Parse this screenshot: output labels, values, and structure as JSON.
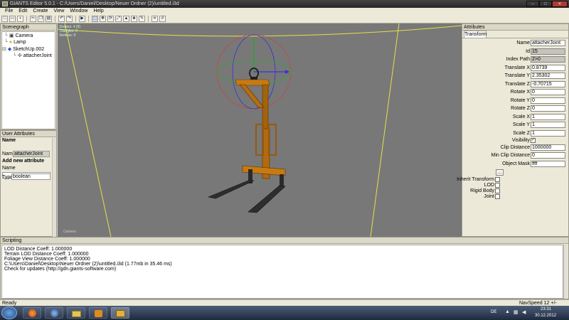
{
  "window": {
    "title": "GIANTS Editor 5.0.1 - C:/Users/Daniel/Desktop/Neuer Ordner (2)/untitled.i3d"
  },
  "menu": [
    "File",
    "Edit",
    "Create",
    "View",
    "Window",
    "Help"
  ],
  "toolbar_icons": [
    "new-icon",
    "open-icon",
    "save-icon",
    "cut-icon",
    "copy-icon",
    "paste-icon",
    "undo-icon",
    "redo-icon",
    "play-icon",
    "select-icon",
    "move-icon",
    "rotate-icon",
    "scale-icon",
    "terrain-icon",
    "foliage-icon",
    "paint-icon",
    "snap-icon"
  ],
  "scenegraph": {
    "title": "Scenegraph",
    "items": [
      {
        "label": "Camera",
        "icon": "camera-icon"
      },
      {
        "label": "Lamp",
        "icon": "lamp-icon"
      },
      {
        "label": "SketchUp.002",
        "icon": "cube-icon"
      },
      {
        "label": "attacherJoint",
        "icon": "joint-icon"
      }
    ]
  },
  "user_attributes": {
    "title": "User Attributes",
    "name_header": "Name",
    "name_label": "Name",
    "name_value": "attacherJoint",
    "add_header": "Add new attribute",
    "new_name_label": "Name",
    "new_name_value": "",
    "type_label": "Type",
    "type_value": "boolean"
  },
  "viewport": {
    "stats": [
      "Shapes: 4 (0)",
      "Triangles: 0",
      "Vertices: 0"
    ],
    "camera_label": "Camera"
  },
  "attributes": {
    "title": "Attributes",
    "tab": "Transform",
    "fields": [
      {
        "label": "Name",
        "value": "attacherJoint"
      },
      {
        "label": "Id",
        "value": "15"
      },
      {
        "label": "Index Path",
        "value": "2>0"
      },
      {
        "label": "Translate X",
        "value": "0.8739"
      },
      {
        "label": "Translate Y",
        "value": "2.35302"
      },
      {
        "label": "Translate Z",
        "value": "-0.70715"
      },
      {
        "label": "Rotate X",
        "value": "0"
      },
      {
        "label": "Rotate Y",
        "value": "0"
      },
      {
        "label": "Rotate Z",
        "value": "0"
      },
      {
        "label": "Scale X",
        "value": "1"
      },
      {
        "label": "Scale Y",
        "value": "1"
      },
      {
        "label": "Scale Z",
        "value": "1"
      }
    ],
    "visibility_label": "Visibility",
    "visibility_checked": true,
    "clip_label": "Clip Distance",
    "clip_value": "1000000",
    "minclip_label": "Min Clip Distance",
    "minclip_value": "0",
    "mask_label": "Object Mask",
    "mask_value": "ffff",
    "mask_button": "...",
    "checkboxes": [
      {
        "label": "Inherit Transform",
        "checked": false
      },
      {
        "label": "LOD",
        "checked": false
      },
      {
        "label": "Rigid Body",
        "checked": false
      },
      {
        "label": "Joint",
        "checked": false
      }
    ]
  },
  "scripting": {
    "title": "Scripting",
    "lines": [
      "LOD Distance Coeff: 1.000000",
      "Terrain LOD Distance Coeff: 1.000000",
      "Foliage View Distance Coeff: 1.000000",
      "C:\\Users\\Daniel\\Desktop\\Neuer Ordner (2)\\untitled.i3d (1.77mb in 35.46 ms)",
      "Check for updates (http://gdn.giants-software.com)"
    ]
  },
  "status": {
    "left": "Ready",
    "right": "NavSpeed 12 +/-"
  },
  "taskbar": {
    "language": "DE",
    "time": "23:31",
    "date": "30.12.2012"
  },
  "colors": {
    "model": "#c77a12",
    "forks": "#2f2f2f",
    "viewport_bg": "#787878",
    "grid_line": "#e8e24a"
  }
}
